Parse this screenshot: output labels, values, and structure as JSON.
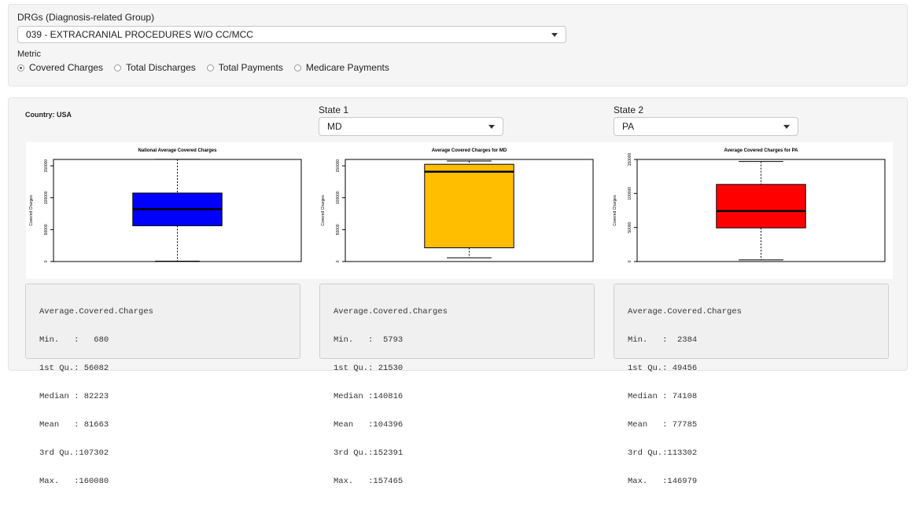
{
  "top_panel": {
    "drg_label": "DRGs (Diagnosis-related Group)",
    "drg_value": "039 - EXTRACRANIAL PROCEDURES W/O CC/MCC",
    "metric_label": "Metric",
    "metrics": [
      {
        "label": "Covered Charges",
        "selected": true
      },
      {
        "label": "Total Discharges",
        "selected": false
      },
      {
        "label": "Total Payments",
        "selected": false
      },
      {
        "label": "Medicare Payments",
        "selected": false
      }
    ]
  },
  "main_panel": {
    "country_label": "Country: USA",
    "state1_label": "State 1",
    "state1_value": "MD",
    "state2_label": "State 2",
    "state2_value": "PA"
  },
  "colors": {
    "national": "#0000ff",
    "md": "#ffbf00",
    "pa": "#ff0000"
  },
  "chart_data": [
    {
      "type": "boxplot",
      "title": "National Average Covered Charges",
      "ylabel": "Covered Charges",
      "y_ticks": [
        0,
        50000,
        100000,
        150000
      ],
      "ylim": [
        0,
        160000
      ],
      "box": {
        "min": 680,
        "q1": 56082,
        "median": 82223,
        "q3": 107302,
        "max": 160080
      },
      "color": "#0000ff"
    },
    {
      "type": "boxplot",
      "title": "Average Covered Charges for MD",
      "ylabel": "Covered Charges",
      "y_ticks": [
        0,
        50000,
        100000,
        150000
      ],
      "ylim": [
        0,
        160000
      ],
      "box": {
        "min": 5793,
        "q1": 21530,
        "median": 140816,
        "q3": 152391,
        "max": 157465
      },
      "color": "#ffbf00"
    },
    {
      "type": "boxplot",
      "title": "Average Covered Charges for PA",
      "ylabel": "Covered Charges",
      "y_ticks": [
        0,
        50000,
        100000,
        150000
      ],
      "ylim": [
        0,
        150000
      ],
      "box": {
        "min": 2384,
        "q1": 49456,
        "median": 74108,
        "q3": 113302,
        "max": 146979
      },
      "color": "#ff0000"
    }
  ],
  "summaries": [
    {
      "header": "Average.Covered.Charges",
      "lines": [
        "Min.   :   680",
        "1st Qu.: 56082",
        "Median : 82223",
        "Mean   : 81663",
        "3rd Qu.:107302",
        "Max.   :160080"
      ]
    },
    {
      "header": "Average.Covered.Charges",
      "lines": [
        "Min.   :  5793",
        "1st Qu.: 21530",
        "Median :140816",
        "Mean   :104396",
        "3rd Qu.:152391",
        "Max.   :157465"
      ]
    },
    {
      "header": "Average.Covered.Charges",
      "lines": [
        "Min.   :  2384",
        "1st Qu.: 49456",
        "Median : 74108",
        "Mean   : 77785",
        "3rd Qu.:113302",
        "Max.   :146979"
      ]
    }
  ]
}
